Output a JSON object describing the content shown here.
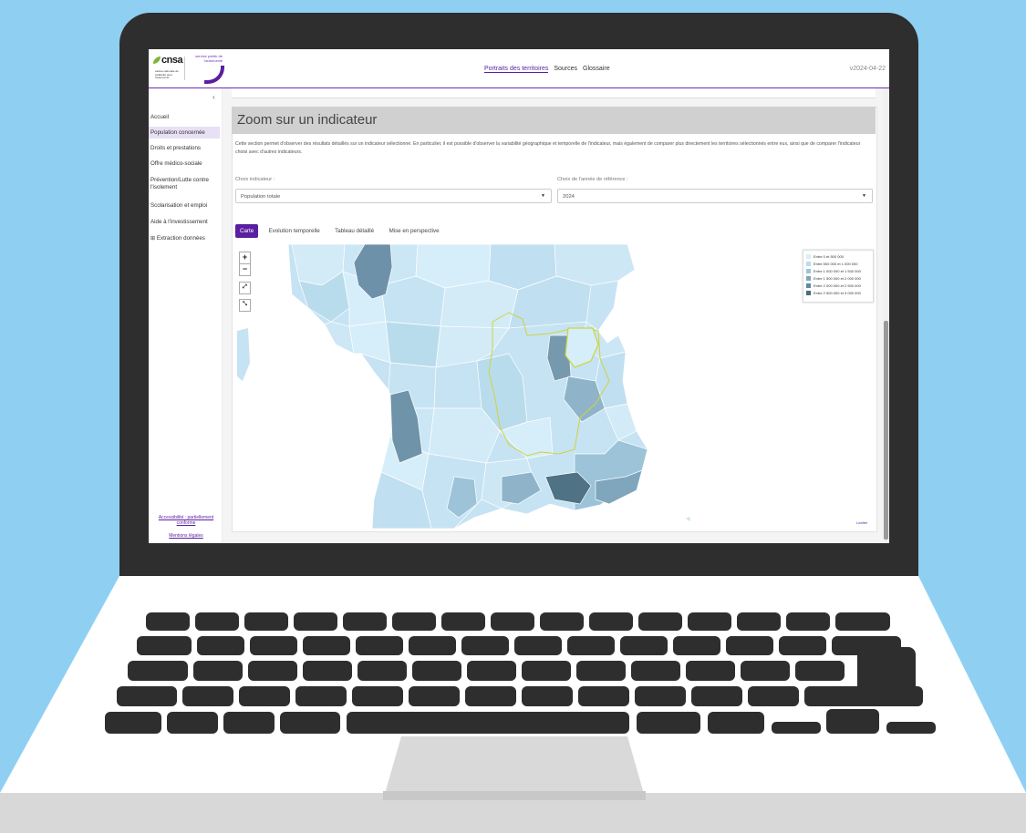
{
  "header": {
    "logo_cnsa": "cnsa",
    "logo_cnsa_sub": "caisse nationale de solidarité pour l'autonomie",
    "logo_sp": "service public de l'autonomie",
    "nav": [
      "Portraits des territoires",
      "Sources",
      "Glossaire"
    ],
    "version": "v2024-04-22"
  },
  "sidebar": {
    "items": [
      {
        "label": "Accueil"
      },
      {
        "label": "Population concernée"
      },
      {
        "label": "Droits et prestations"
      },
      {
        "label": "Offre médico-sociale"
      },
      {
        "label": "Prévention/Lutte contre l'isolement"
      },
      {
        "label": "Scolarisation et emploi"
      },
      {
        "label": "Aide à l'investissement"
      },
      {
        "label": "Extraction données"
      }
    ],
    "footer": [
      "Accessibilité : partiellement conforme",
      "Mentions légales"
    ]
  },
  "section": {
    "title": "Zoom sur un indicateur",
    "description": "Cette section permet d'observer des résultats détaillés sur un indicateur sélectionné. En particulier, il est possible d'observer la variabilité géographique et temporelle de l'indicateur, mais également de comparer plus directement les territoires sélectionnés entre eux, ainsi que de comparer l'indicateur choisi avec d'autres indicateurs.",
    "indicator_label": "Choix indicateur :",
    "indicator_value": "Population totale",
    "year_label": "Choix de l'année de référence :",
    "year_value": "2024",
    "tabs": [
      "Carte",
      "Evolution temporelle",
      "Tableau détaillé",
      "Mise en perspective"
    ]
  },
  "map": {
    "zoom_in": "+",
    "zoom_out": "−",
    "legend": [
      {
        "label": "Entre 0 et 500 000",
        "color": "#d6eef9"
      },
      {
        "label": "Entre 500 000 et 1 000 000",
        "color": "#b9dcec"
      },
      {
        "label": "Entre 1 000 000 et 1 500 000",
        "color": "#9cc3d8"
      },
      {
        "label": "Entre 1 500 000 et 2 000 000",
        "color": "#7fa6bd"
      },
      {
        "label": "Entre 2 000 000 et 2 500 000",
        "color": "#62889f"
      },
      {
        "label": "Entre 2 500 000 et 3 000 000",
        "color": "#486c80"
      }
    ],
    "attribution": "Leaflet",
    "highlight_color": "#cdd43a"
  }
}
